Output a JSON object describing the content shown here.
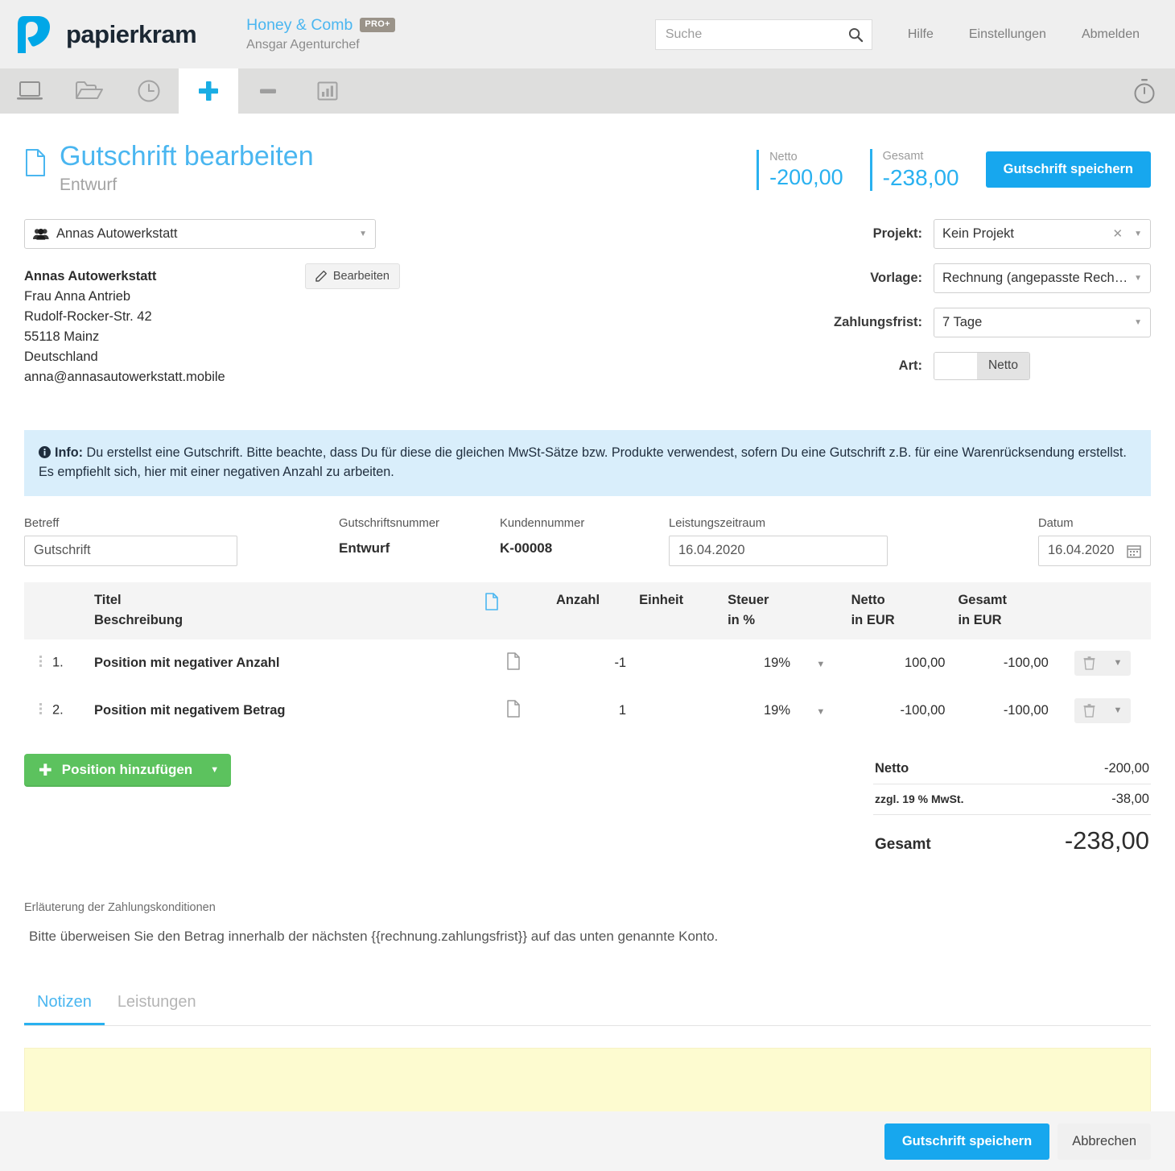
{
  "header": {
    "brand": "papierkram",
    "tenant_name": "Honey & Comb",
    "tenant_badge": "PRO+",
    "tenant_user": "Ansgar Agenturchef",
    "search_placeholder": "Suche",
    "search_value": "",
    "links": [
      "Hilfe",
      "Einstellungen",
      "Abmelden"
    ]
  },
  "nav": {
    "items": [
      {
        "icon": "laptop-icon",
        "active": false
      },
      {
        "icon": "folder-open-icon",
        "active": false
      },
      {
        "icon": "clock-icon",
        "active": false
      },
      {
        "icon": "plus-icon",
        "active": true
      },
      {
        "icon": "minus-icon",
        "active": false
      },
      {
        "icon": "bar-chart-icon",
        "active": false
      }
    ],
    "right_icon": "stopwatch-icon"
  },
  "page": {
    "title": "Gutschrift bearbeiten",
    "subtitle": "Entwurf",
    "kpis": [
      {
        "label": "Netto",
        "value": "-200,00"
      },
      {
        "label": "Gesamt",
        "value": "-238,00"
      }
    ],
    "save_button": "Gutschrift speichern"
  },
  "customer": {
    "selected": "Annas Autowerkstatt",
    "edit_button": "Bearbeiten",
    "address": [
      "Annas Autowerkstatt",
      "Frau Anna Antrieb",
      "Rudolf-Rocker-Str. 42",
      "55118 Mainz",
      "Deutschland",
      "anna@annasautowerkstatt.mobile"
    ]
  },
  "settings": {
    "projekt_label": "Projekt:",
    "projekt_value": "Kein Projekt",
    "vorlage_label": "Vorlage:",
    "vorlage_value": "Rechnung (angepasste Rech…",
    "zahlungsfrist_label": "Zahlungsfrist:",
    "zahlungsfrist_value": "7 Tage",
    "art_label": "Art:",
    "art_value": "Netto"
  },
  "info": {
    "prefix": "Info:",
    "text": " Du erstellst eine Gutschrift. Bitte beachte, dass Du für diese die gleichen MwSt-Sätze bzw. Produkte verwendest, sofern Du eine Gutschrift z.B. für eine Warenrücksendung erstellst. Es empfiehlt sich, hier mit einer negativen Anzahl zu arbeiten."
  },
  "meta": {
    "betreff_label": "Betreff",
    "betreff_value": "Gutschrift",
    "gutschriftsnummer_label": "Gutschriftsnummer",
    "gutschriftsnummer_value": "Entwurf",
    "kundennummer_label": "Kundennummer",
    "kundennummer_value": "K-00008",
    "leistungszeitraum_label": "Leistungszeitraum",
    "leistungszeitraum_value": "16.04.2020",
    "datum_label": "Datum",
    "datum_value": "16.04.2020"
  },
  "items_table": {
    "columns": {
      "titel": "Titel",
      "beschreibung": "Beschreibung",
      "doc_icon": "document-icon",
      "anzahl": "Anzahl",
      "einheit": "Einheit",
      "steuer": "Steuer",
      "steuer_sub": "in %",
      "netto": "Netto",
      "netto_sub": "in EUR",
      "gesamt": "Gesamt",
      "gesamt_sub": "in EUR"
    },
    "rows": [
      {
        "index": "1.",
        "title": "Position mit negativer Anzahl",
        "anzahl": "-1",
        "einheit": "",
        "steuer": "19%",
        "netto": "100,00",
        "gesamt": "-100,00"
      },
      {
        "index": "2.",
        "title": "Position mit negativem Betrag",
        "anzahl": "1",
        "einheit": "",
        "steuer": "19%",
        "netto": "-100,00",
        "gesamt": "-100,00"
      }
    ]
  },
  "add_position": {
    "label": "Position hinzufügen"
  },
  "totals": {
    "netto_label": "Netto",
    "netto_value": "-200,00",
    "mwst_label": "zzgl. 19 % MwSt.",
    "mwst_value": "-38,00",
    "gesamt_label": "Gesamt",
    "gesamt_value": "-238,00"
  },
  "terms": {
    "label": "Erläuterung der Zahlungskonditionen",
    "text": "Bitte überweisen Sie den Betrag innerhalb der nächsten {{rechnung.zahlungsfrist}} auf das unten genannte Konto."
  },
  "tabs": [
    {
      "label": "Notizen",
      "active": true
    },
    {
      "label": "Leistungen",
      "active": false
    }
  ],
  "notes": {
    "value": ""
  },
  "footer": {
    "save_label": "Gutschrift speichern",
    "cancel_label": "Abbrechen"
  },
  "colors": {
    "accent": "#29b1f0",
    "brand_blue": "#00a7e7",
    "green": "#52c15e",
    "add_green": "#5cc25e",
    "info_bg": "#d9eefb",
    "notes_bg": "#fdfbd0"
  }
}
